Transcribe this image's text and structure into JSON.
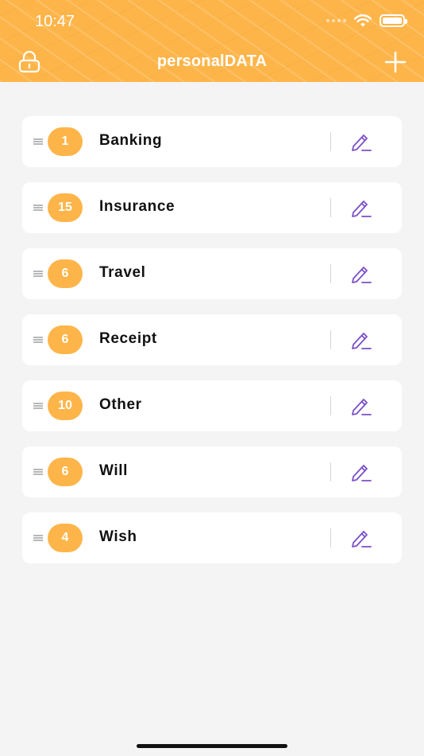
{
  "status_bar": {
    "time": "10:47"
  },
  "nav": {
    "title": "personalDATA"
  },
  "categories": [
    {
      "count": "1",
      "label": "Banking"
    },
    {
      "count": "15",
      "label": "Insurance"
    },
    {
      "count": "6",
      "label": "Travel"
    },
    {
      "count": "6",
      "label": "Receipt"
    },
    {
      "count": "10",
      "label": "Other"
    },
    {
      "count": "6",
      "label": "Will"
    },
    {
      "count": "4",
      "label": "Wish"
    }
  ],
  "colors": {
    "accent": "#fdb54a",
    "edit_icon": "#7b4fc8",
    "background": "#f4f4f4"
  },
  "icons": {
    "lock": "lock-icon",
    "add": "plus-icon",
    "edit": "pencil-icon",
    "drag": "drag-handle-icon",
    "wifi": "wifi-icon",
    "battery": "battery-icon"
  }
}
